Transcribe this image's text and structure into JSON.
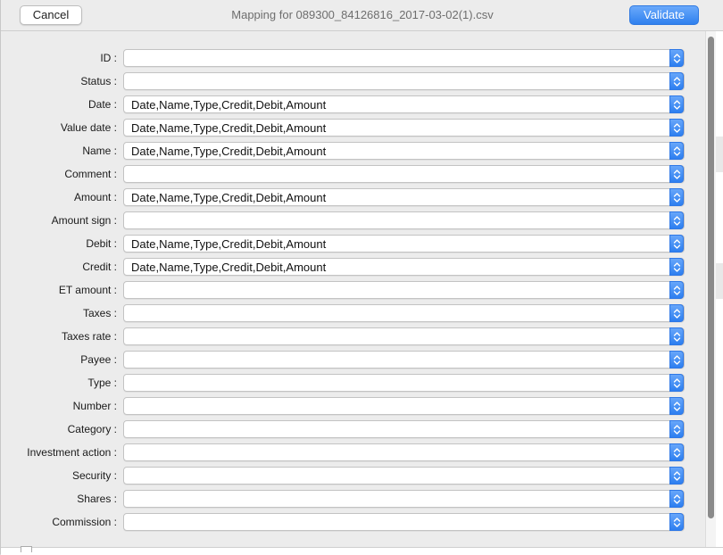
{
  "dialog": {
    "title": "Mapping for 089300_84126816_2017-03-02(1).csv",
    "cancel_label": "Cancel",
    "validate_label": "Validate"
  },
  "fields": [
    {
      "label": "ID :",
      "value": ""
    },
    {
      "label": "Status :",
      "value": ""
    },
    {
      "label": "Date :",
      "value": "Date,Name,Type,Credit,Debit,Amount"
    },
    {
      "label": "Value date :",
      "value": "Date,Name,Type,Credit,Debit,Amount"
    },
    {
      "label": "Name :",
      "value": "Date,Name,Type,Credit,Debit,Amount"
    },
    {
      "label": "Comment :",
      "value": ""
    },
    {
      "label": "Amount :",
      "value": "Date,Name,Type,Credit,Debit,Amount"
    },
    {
      "label": "Amount sign :",
      "value": ""
    },
    {
      "label": "Debit :",
      "value": "Date,Name,Type,Credit,Debit,Amount"
    },
    {
      "label": "Credit :",
      "value": "Date,Name,Type,Credit,Debit,Amount"
    },
    {
      "label": "ET amount :",
      "value": ""
    },
    {
      "label": "Taxes :",
      "value": ""
    },
    {
      "label": "Taxes rate :",
      "value": ""
    },
    {
      "label": "Payee :",
      "value": ""
    },
    {
      "label": "Type :",
      "value": ""
    },
    {
      "label": "Number :",
      "value": ""
    },
    {
      "label": "Category :",
      "value": ""
    },
    {
      "label": "Investment action :",
      "value": ""
    },
    {
      "label": "Security :",
      "value": ""
    },
    {
      "label": "Shares :",
      "value": ""
    },
    {
      "label": "Commission :",
      "value": ""
    }
  ],
  "colors": {
    "accent": "#2f80ee",
    "background": "#ececec"
  },
  "icons": {
    "stepper": "chevron-up-down-icon"
  }
}
